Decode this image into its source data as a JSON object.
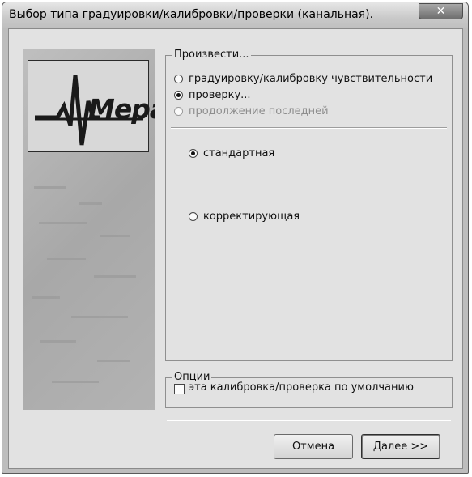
{
  "window": {
    "title": "Выбор типа градуировки/калибровки/проверки (канальная).",
    "close_glyph": "✕"
  },
  "logo": {
    "text": "Мера"
  },
  "produce_group": {
    "caption": "Произвести...",
    "options": [
      {
        "label": "градуировку/калибровку чувствительности",
        "checked": false,
        "disabled": false
      },
      {
        "label": "проверку...",
        "checked": true,
        "disabled": false
      },
      {
        "label": "продолжение последней",
        "checked": false,
        "disabled": true
      }
    ],
    "sub_options": [
      {
        "label": "стандартная",
        "checked": true
      },
      {
        "label": "корректирующая",
        "checked": false
      }
    ]
  },
  "options_group": {
    "caption": "Опции",
    "default_checkbox": {
      "label": "эта калибровка/проверка по умолчанию",
      "checked": false
    }
  },
  "buttons": {
    "cancel": "Отмена",
    "next": "Далее >>"
  }
}
